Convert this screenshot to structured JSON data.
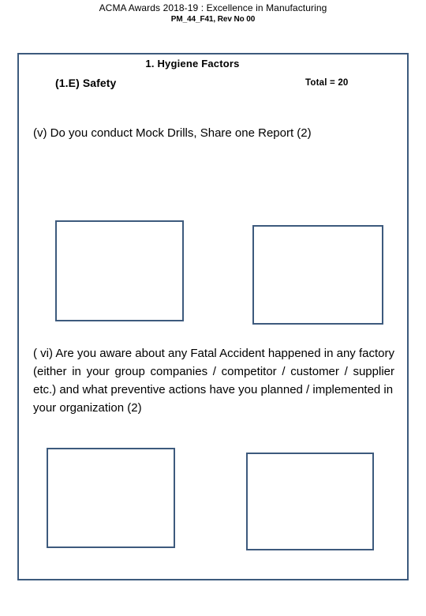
{
  "header": {
    "title": "ACMA  Awards 2018-19 :  Excellence in Manufacturing",
    "subtitle": "PM_44_F41, Rev No 00"
  },
  "form": {
    "section_heading": "1. Hygiene Factors",
    "subsection_label": "(1.E)  Safety",
    "total_label": "Total  = 20",
    "questions": [
      {
        "id": "v",
        "text": "(v)  Do you conduct Mock Drills, Share  one Report (2)",
        "marks": "(2)"
      },
      {
        "id": "vi",
        "text": "( vi) Are you aware about any Fatal Accident happened in any factory (either in your group companies / competitor / customer / supplier etc.) and what preventive actions have you planned / implemented in",
        "text_lastline": "your organization (2)",
        "marks": "(2)"
      }
    ],
    "answer_boxes": [
      {
        "id": "v-left",
        "label": ""
      },
      {
        "id": "v-right",
        "label": ""
      },
      {
        "id": "vi-left",
        "label": ""
      },
      {
        "id": "vi-right",
        "label": ""
      }
    ]
  },
  "colors": {
    "frame": "#3D5A7D",
    "text": "#000000",
    "background": "#FFFFFF"
  }
}
